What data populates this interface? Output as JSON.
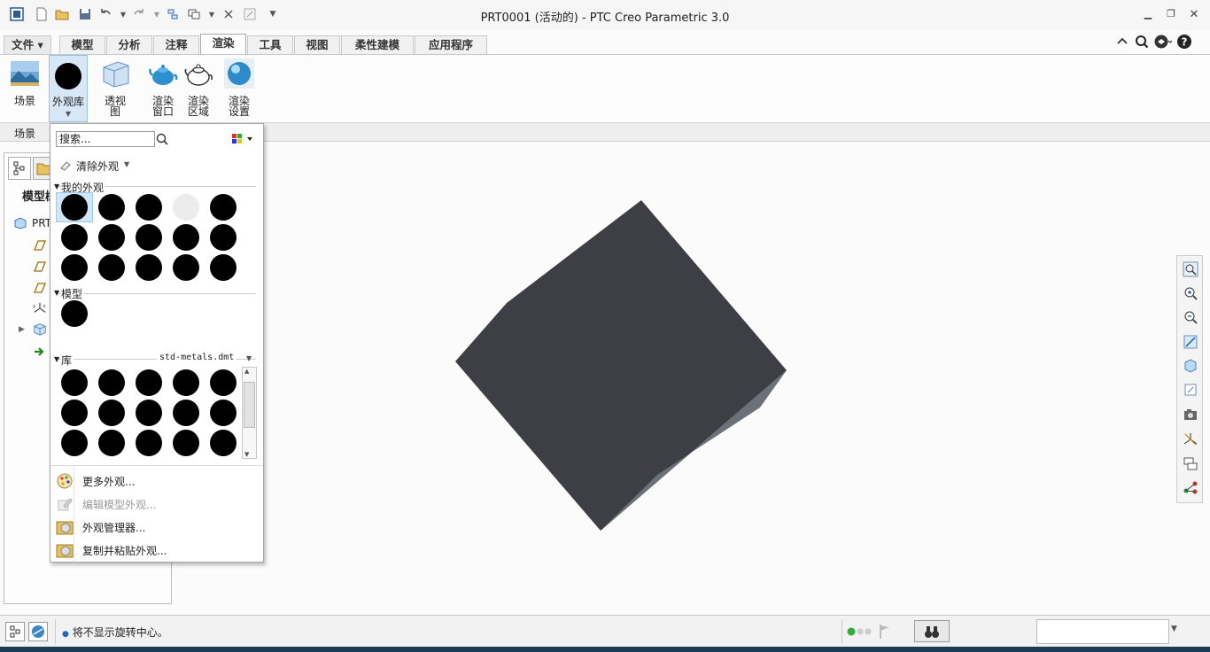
{
  "window": {
    "title": "PRT0001 (活动的) - PTC Creo Parametric 3.0"
  },
  "tabs": [
    {
      "label": "文件"
    },
    {
      "label": "模型"
    },
    {
      "label": "分析"
    },
    {
      "label": "注释"
    },
    {
      "label": "渲染"
    },
    {
      "label": "工具"
    },
    {
      "label": "视图"
    },
    {
      "label": "柔性建模"
    },
    {
      "label": "应用程序"
    }
  ],
  "ribbon": {
    "scene": {
      "label": "场景"
    },
    "appearance_library": {
      "label": "外观库"
    },
    "perspective": {
      "label_line1": "透视",
      "label_line2": "图"
    },
    "render_window": {
      "label_line1": "渲染",
      "label_line2": "窗口"
    },
    "render_region": {
      "label_line1": "渲染",
      "label_line2": "区域"
    },
    "render_settings": {
      "label_line1": "渲染",
      "label_line2": "设置"
    },
    "group_label": "场景"
  },
  "left_panel": {
    "title": "模型树",
    "root_label": "PRT"
  },
  "dropdown": {
    "search_placeholder": "搜索...",
    "clear_label": "清除外观",
    "my_appearances_label": "我的外观",
    "model_label": "模型",
    "library_label": "库",
    "library_file": "std-metals.dmt",
    "menu": [
      {
        "label": "更多外观...",
        "enabled": true
      },
      {
        "label": "编辑模型外观...",
        "enabled": false
      },
      {
        "label": "外观管理器...",
        "enabled": true
      },
      {
        "label": "复制并粘贴外观...",
        "enabled": true
      }
    ]
  },
  "status": {
    "message": "将不显示旋转中心。"
  },
  "colors": {
    "accent": "#2f77c6",
    "model_color": "#3d3f45",
    "model_side": "#6c7078",
    "selected_bg": "#cfe6fb"
  }
}
